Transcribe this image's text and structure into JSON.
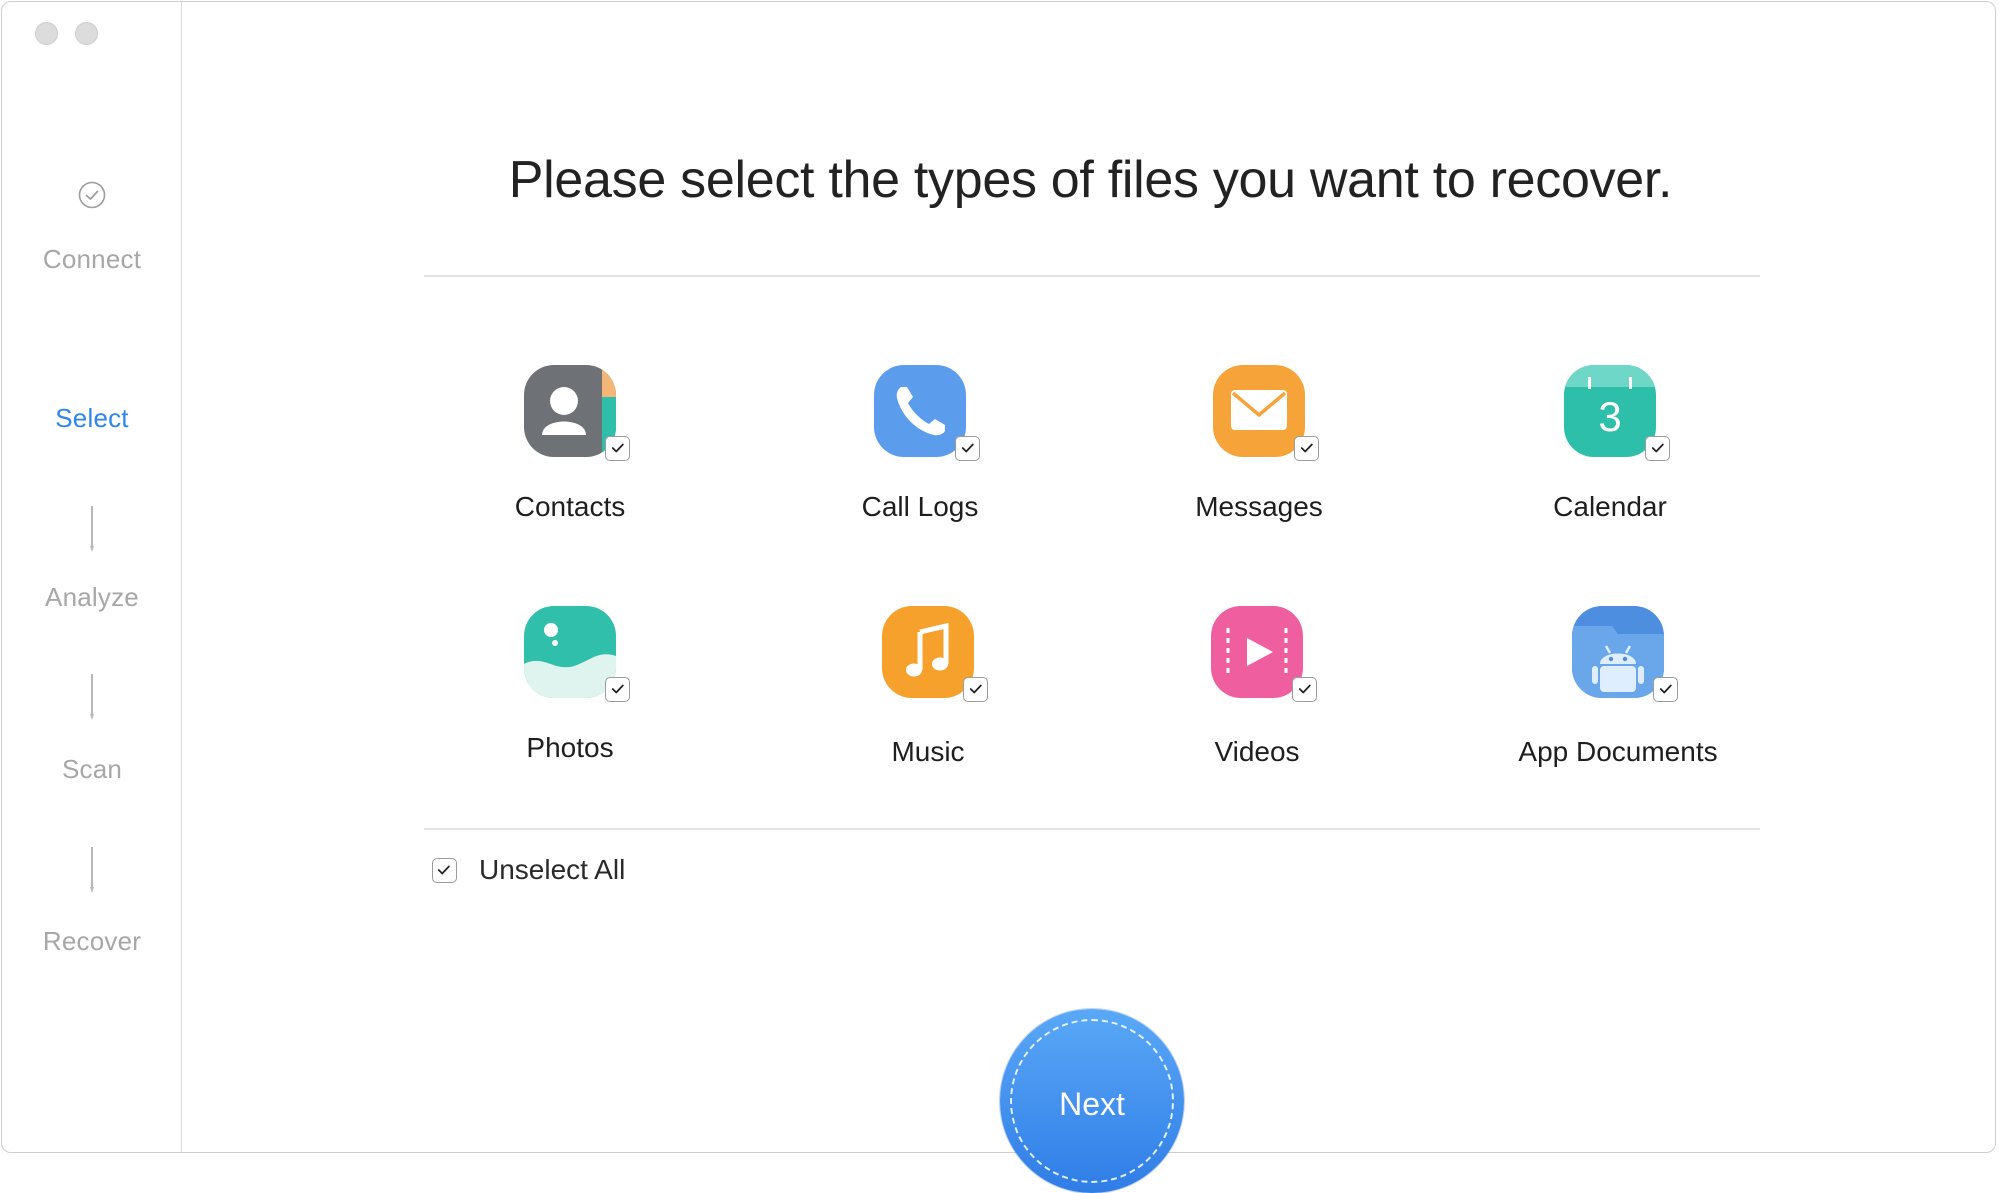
{
  "window": {
    "buttons": [
      "close",
      "minimize"
    ]
  },
  "sidebar": {
    "steps": [
      {
        "label": "Connect",
        "state": "done",
        "icon": "check-circle-icon"
      },
      {
        "label": "Select",
        "state": "active"
      },
      {
        "label": "Analyze",
        "state": "pending",
        "icon": "arrow-down-icon"
      },
      {
        "label": "Scan",
        "state": "pending",
        "icon": "arrow-down-icon"
      },
      {
        "label": "Recover",
        "state": "pending",
        "icon": "arrow-down-icon"
      }
    ]
  },
  "main": {
    "title": "Please select the types of files you want to recover.",
    "file_types": [
      {
        "label": "Contacts",
        "icon": "contacts-icon",
        "color": "#6e7277",
        "checked": true
      },
      {
        "label": "Call Logs",
        "icon": "phone-icon",
        "color": "#5c9cec",
        "checked": true
      },
      {
        "label": "Messages",
        "icon": "envelope-icon",
        "color": "#f6a43a",
        "checked": true
      },
      {
        "label": "Calendar",
        "icon": "calendar-icon",
        "color": "#2dbfa9",
        "checked": true,
        "calendar_day": "3"
      },
      {
        "label": "Photos",
        "icon": "photos-icon",
        "color": "#2fbfaa",
        "checked": true
      },
      {
        "label": "Music",
        "icon": "music-note-icon",
        "color": "#f6a12c",
        "checked": true
      },
      {
        "label": "Videos",
        "icon": "play-icon",
        "color": "#ef5fa0",
        "checked": true
      },
      {
        "label": "App Documents",
        "icon": "android-icon",
        "color": "#4e8ee0",
        "checked": true
      }
    ],
    "unselect_all": {
      "label": "Unselect All",
      "checked": true
    },
    "next_button": {
      "label": "Next",
      "color": "#3a8bea"
    }
  },
  "colors": {
    "accent": "#2f86e8",
    "inactive_step": "#a7a7a7"
  }
}
